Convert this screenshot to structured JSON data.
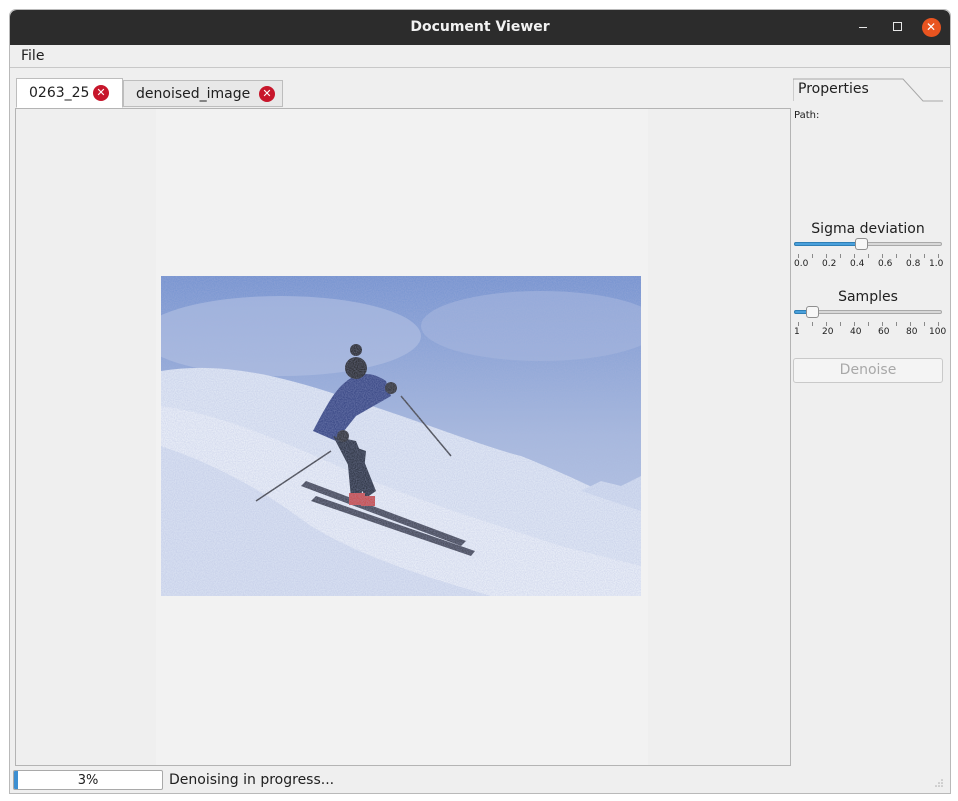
{
  "window": {
    "title": "Document Viewer"
  },
  "menu": {
    "file": "File"
  },
  "tabs": [
    {
      "label": "0263_25",
      "active": true
    },
    {
      "label": "denoised_image",
      "active": false
    }
  ],
  "icons": {
    "tab_close": "close-circle-icon",
    "window_close": "close-icon",
    "minimize": "minimize-icon",
    "maximize": "maximize-icon"
  },
  "properties": {
    "tab_label": "Properties",
    "path_label": "Path:",
    "sigma": {
      "title": "Sigma deviation",
      "value": 0.45,
      "ticks": [
        "0.0",
        "0.2",
        "0.4",
        "0.6",
        "0.8",
        "1.0"
      ]
    },
    "samples": {
      "title": "Samples",
      "value": 10,
      "ticks": [
        "1",
        "20",
        "40",
        "60",
        "80",
        "100"
      ]
    },
    "denoise_button": "Denoise"
  },
  "status": {
    "progress_value": 0.03,
    "progress_text": "3%",
    "message": "Denoising in progress..."
  },
  "colors": {
    "accent": "#e95420",
    "close_badge": "#c7162b",
    "slider_fill": "#4aa0db"
  }
}
